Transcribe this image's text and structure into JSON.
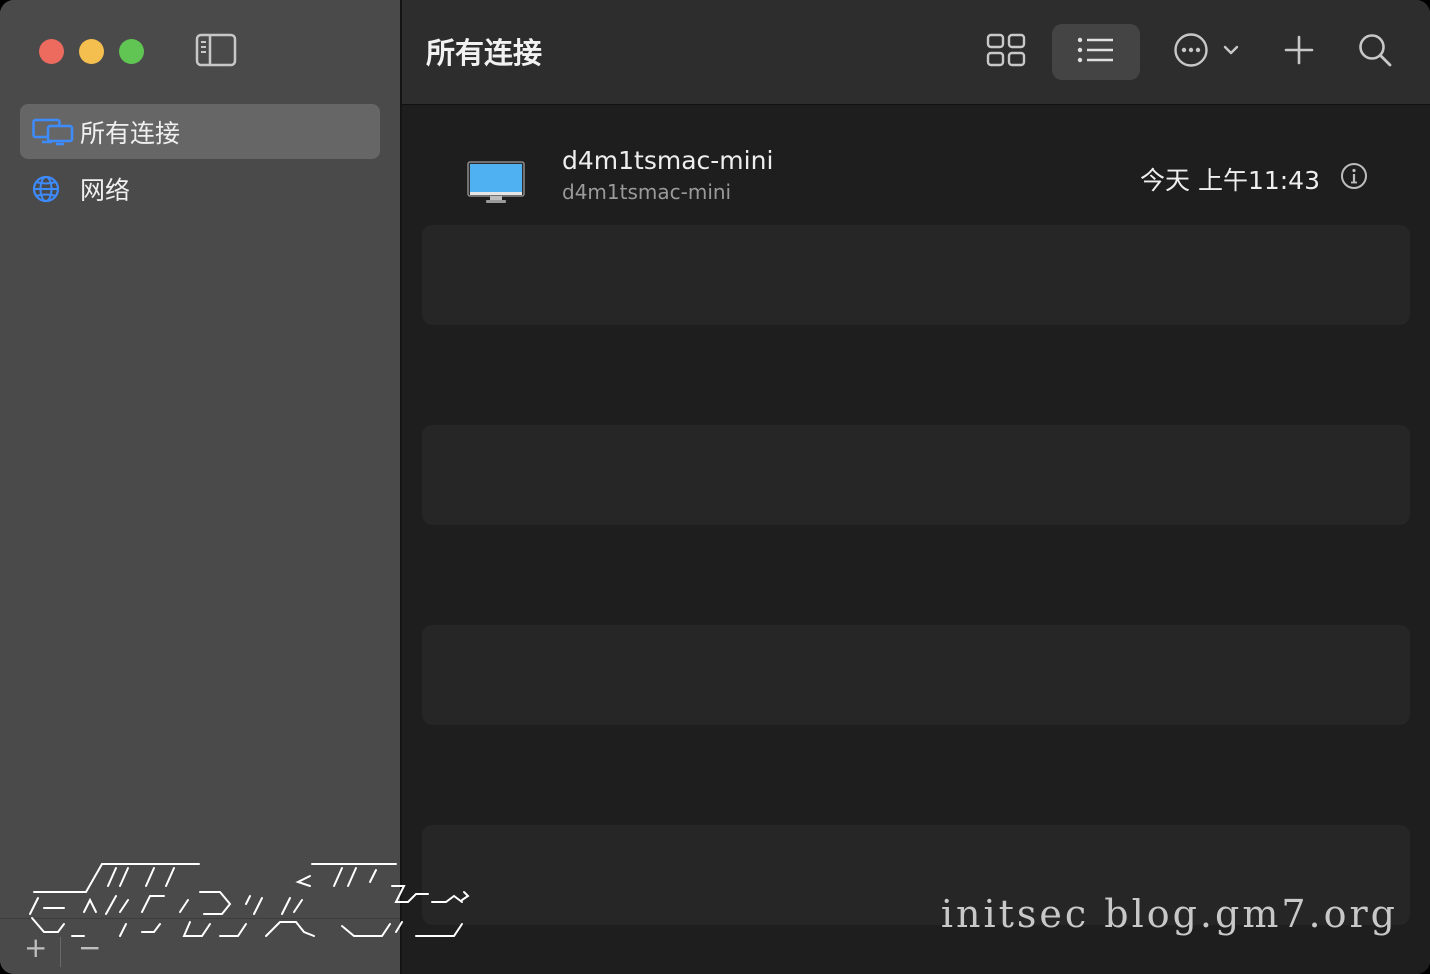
{
  "window": {
    "title": "所有连接"
  },
  "sidebar": {
    "items": [
      {
        "label": "所有连接",
        "icon": "displays-icon",
        "selected": true
      },
      {
        "label": "网络",
        "icon": "globe-icon",
        "selected": false
      }
    ],
    "footer": {
      "add_label": "+",
      "remove_label": "−"
    }
  },
  "toolbar": {
    "title": "所有连接",
    "buttons": [
      "grid-view-icon",
      "list-view-icon",
      "more-menu-icon",
      "add-icon",
      "search-icon"
    ],
    "active_view": "list"
  },
  "connections": [
    {
      "name": "d4m1tsmac-mini",
      "subtitle": "d4m1tsmac-mini",
      "time": "今天 上午11:43",
      "icon": "monitor-icon"
    }
  ],
  "watermark": {
    "right_text": "initsec  blog.gm7.org"
  },
  "colors": {
    "accent": "#3d8bfd",
    "traffic_red": "#ed6a5e",
    "traffic_yellow": "#f5bf4f",
    "traffic_green": "#61c554"
  }
}
